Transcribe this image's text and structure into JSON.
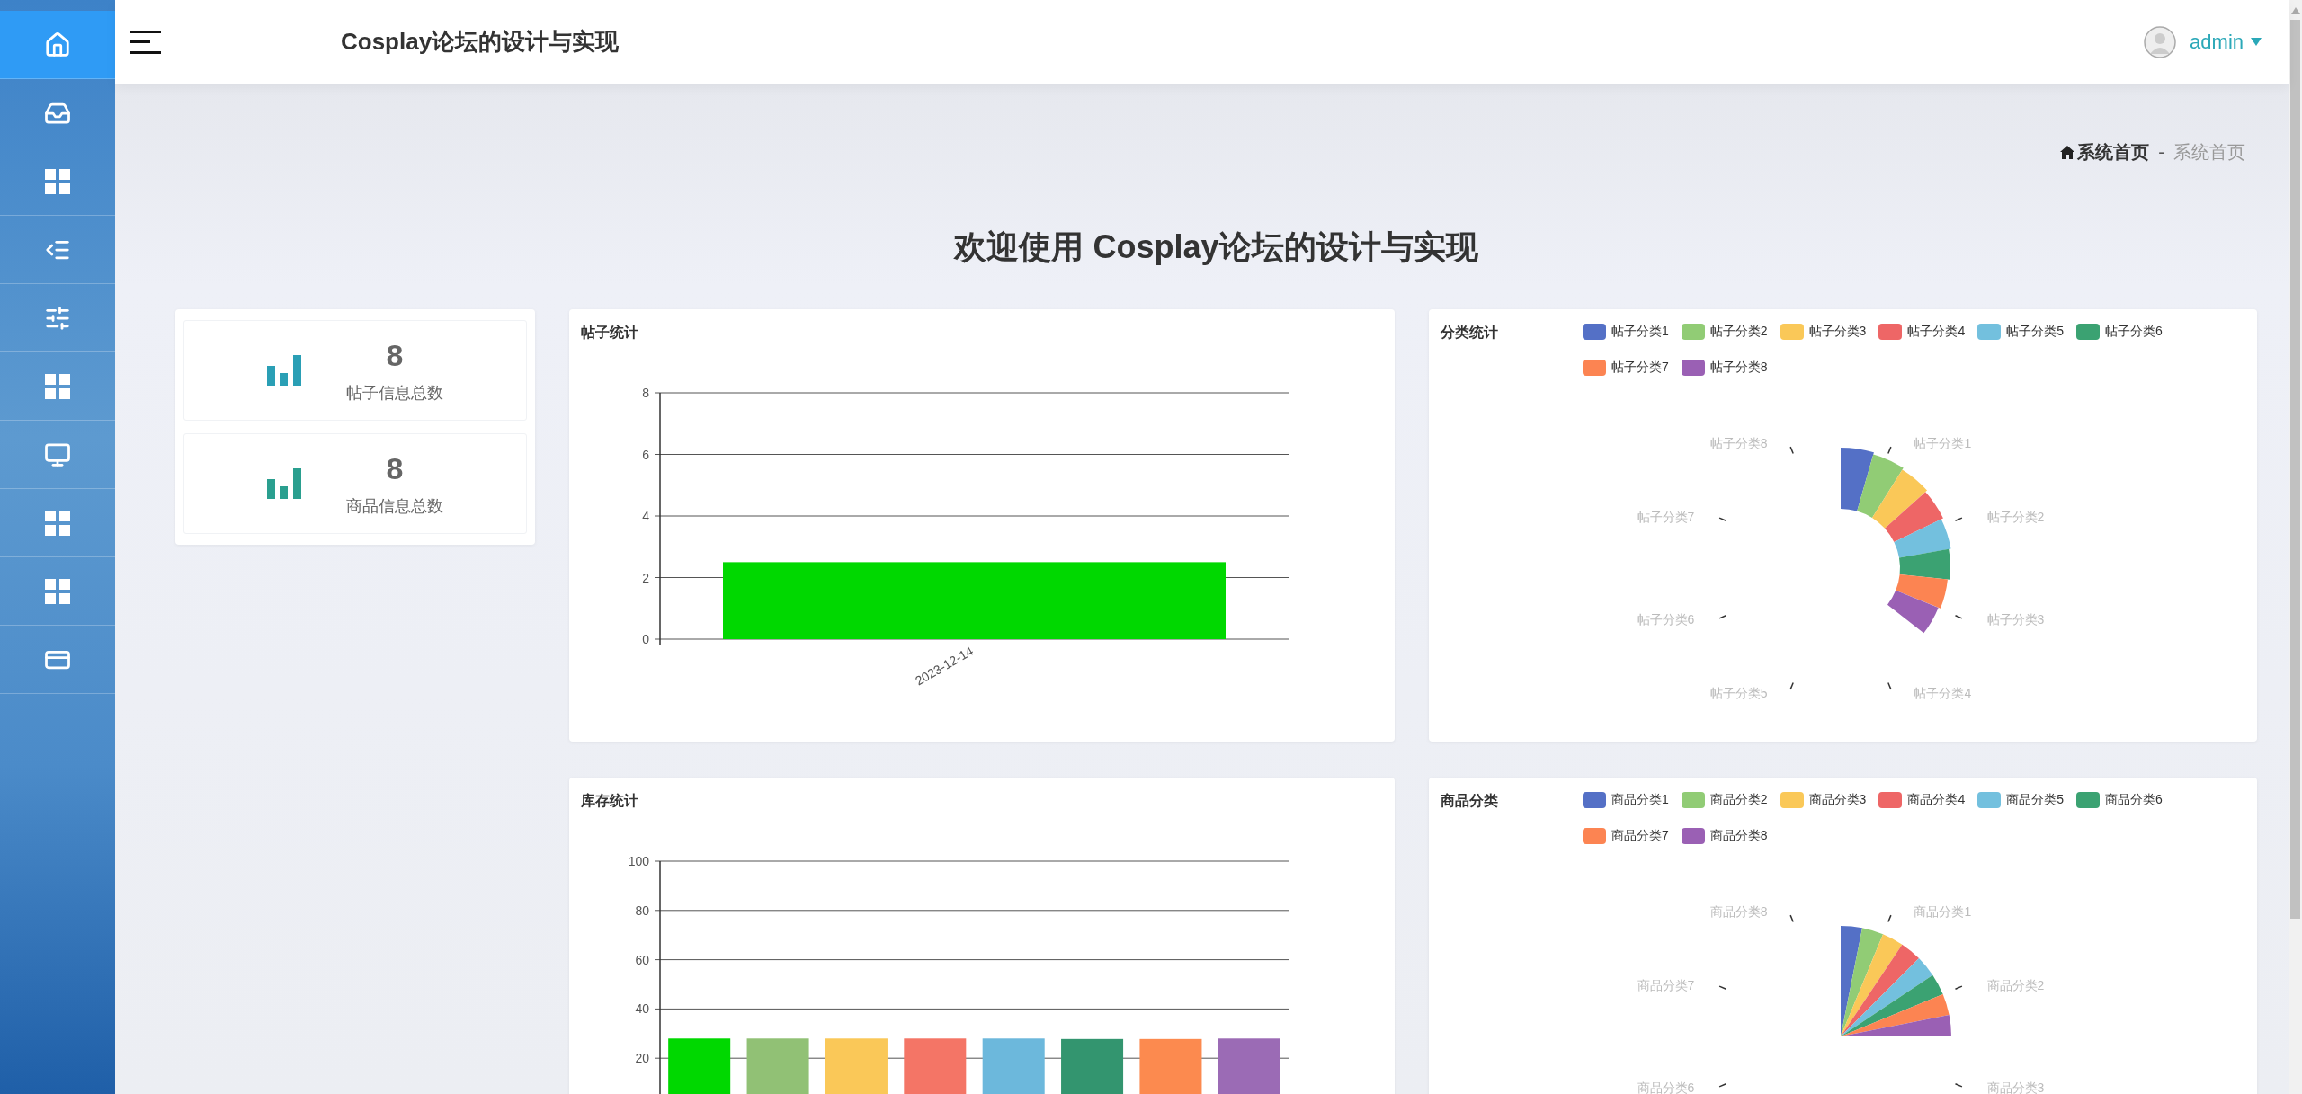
{
  "sidebar": {
    "items": [
      {
        "kind": "home",
        "selected": true
      },
      {
        "kind": "tray",
        "selected": false
      },
      {
        "kind": "grid",
        "selected": false
      },
      {
        "kind": "list",
        "selected": false
      },
      {
        "kind": "sliders",
        "selected": false
      },
      {
        "kind": "grid",
        "selected": false
      },
      {
        "kind": "monitor",
        "selected": false
      },
      {
        "kind": "grid",
        "selected": false
      },
      {
        "kind": "grid",
        "selected": false
      },
      {
        "kind": "card",
        "selected": false
      }
    ]
  },
  "header": {
    "title": "Cosplay论坛的设计与实现",
    "user": "admin"
  },
  "breadcrumb": {
    "home": "系统首页",
    "separator": "-",
    "current": "系统首页"
  },
  "welcome_title": "欢迎使用 Cosplay论坛的设计与实现",
  "stats": [
    {
      "value": "8",
      "label": "帖子信息总数"
    },
    {
      "value": "8",
      "label": "商品信息总数"
    }
  ],
  "post_stats": {
    "title": "帖子统计",
    "chart_data": {
      "type": "bar",
      "categories": [
        "2023-12-14"
      ],
      "values": [
        2.5
      ],
      "ylim": [
        0,
        8
      ],
      "yticks": [
        0,
        2,
        4,
        6,
        8
      ],
      "grid": true
    }
  },
  "category_stats": {
    "title": "分类统计",
    "legend": [
      {
        "label": "帖子分类1",
        "color": "#5470c6"
      },
      {
        "label": "帖子分类2",
        "color": "#91cc75"
      },
      {
        "label": "帖子分类3",
        "color": "#fac858"
      },
      {
        "label": "帖子分类4",
        "color": "#ee6666"
      },
      {
        "label": "帖子分类5",
        "color": "#73c0de"
      },
      {
        "label": "帖子分类6",
        "color": "#3ba272"
      },
      {
        "label": "帖子分类7",
        "color": "#fc8452"
      },
      {
        "label": "帖子分类8",
        "color": "#9a60b4"
      }
    ],
    "slice_labels": {
      "right": [
        "帖子分类1",
        "帖子分类2",
        "帖子分类3",
        "帖子分类4"
      ],
      "left": [
        "帖子分类8",
        "帖子分类7",
        "帖子分类6",
        "帖子分类5"
      ]
    }
  },
  "inventory_stats": {
    "title": "库存统计",
    "chart_data": {
      "type": "bar",
      "values": [
        28,
        28,
        28,
        28,
        28,
        27.8,
        27.8,
        28
      ],
      "ylim": [
        0,
        100
      ],
      "yticks": [
        20,
        40,
        60,
        80,
        100
      ],
      "grid": true
    },
    "bars": [
      {
        "color": "#00d800"
      },
      {
        "color": "#91c175"
      },
      {
        "color": "#fac858"
      },
      {
        "color": "#f47566"
      },
      {
        "color": "#6cb8dc"
      },
      {
        "color": "#33956f"
      },
      {
        "color": "#fc8a4f"
      },
      {
        "color": "#9b6bb5"
      }
    ]
  },
  "product_categories": {
    "title": "商品分类",
    "legend": [
      {
        "label": "商品分类1",
        "color": "#5470c6"
      },
      {
        "label": "商品分类2",
        "color": "#91cc75"
      },
      {
        "label": "商品分类3",
        "color": "#fac858"
      },
      {
        "label": "商品分类4",
        "color": "#ee6666"
      },
      {
        "label": "商品分类5",
        "color": "#73c0de"
      },
      {
        "label": "商品分类6",
        "color": "#3ba272"
      },
      {
        "label": "商品分类7",
        "color": "#fc8452"
      },
      {
        "label": "商品分类8",
        "color": "#9a60b4"
      }
    ],
    "slice_labels": {
      "right": [
        "商品分类1",
        "商品分类2",
        "商品分类3"
      ],
      "left": [
        "商品分类8",
        "商品分类7",
        "商品分类6"
      ]
    }
  }
}
